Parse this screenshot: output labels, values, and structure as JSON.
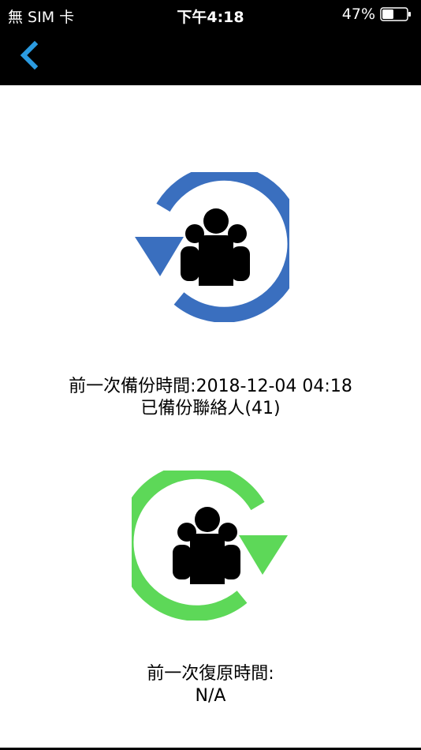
{
  "status_bar": {
    "carrier": "無 SIM 卡",
    "time": "下午4:18",
    "battery_percent": "47%",
    "battery_level": 0.47
  },
  "nav": {
    "back_icon": "chevron-left-icon",
    "back_color": "#2b9be0"
  },
  "backup": {
    "icon": "contacts-backup-icon",
    "color": "#3a6fbf",
    "last_time_line": "前一次備份時間:2018-12-04 04:18",
    "count_line": "已備份聯絡人(41)"
  },
  "restore": {
    "icon": "contacts-restore-icon",
    "color": "#5dd858",
    "last_time_line": "前一次復原時間:",
    "value_line": "N/A"
  }
}
